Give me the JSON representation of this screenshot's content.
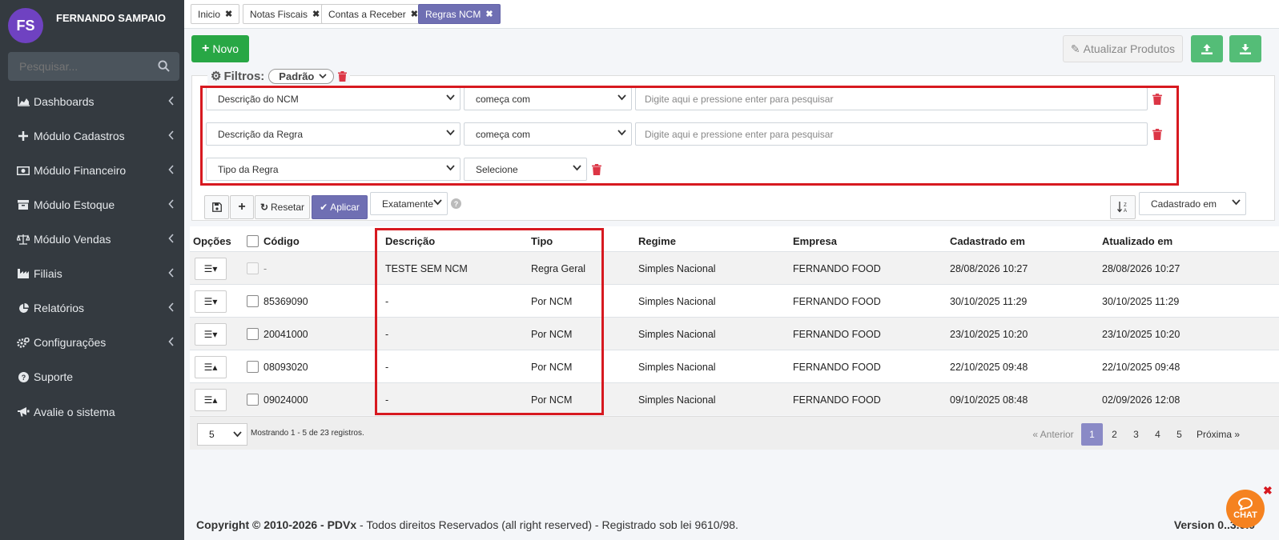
{
  "user": {
    "initials": "FS",
    "name": "FERNANDO SAMPAIO"
  },
  "sidebar": {
    "search_placeholder": "Pesquisar...",
    "items": [
      {
        "label": "Dashboards",
        "icon": "chart-area-icon"
      },
      {
        "label": "Módulo Cadastros",
        "icon": "plus-icon"
      },
      {
        "label": "Módulo Financeiro",
        "icon": "money-icon"
      },
      {
        "label": "Módulo Estoque",
        "icon": "archive-icon"
      },
      {
        "label": "Módulo Vendas",
        "icon": "balance-scale-icon"
      },
      {
        "label": "Filiais",
        "icon": "industry-icon"
      },
      {
        "label": "Relatórios",
        "icon": "pie-chart-icon"
      },
      {
        "label": "Configurações",
        "icon": "cogs-icon"
      },
      {
        "label": "Suporte",
        "icon": "question-circle-icon"
      },
      {
        "label": "Avalie o sistema",
        "icon": "bullhorn-icon"
      }
    ]
  },
  "tabs": [
    {
      "label": "Inicio"
    },
    {
      "label": "Notas Fiscais"
    },
    {
      "label": "Contas a Receber"
    },
    {
      "label": "Regras NCM"
    }
  ],
  "toolbar": {
    "novo": "Novo",
    "atualizar": "Atualizar Produtos"
  },
  "filters": {
    "legend": "Filtros:",
    "preset": "Padrão",
    "rows": [
      {
        "field": "Descrição do NCM",
        "operator": "começa com",
        "placeholder": "Digite aqui e pressione enter para pesquisar"
      },
      {
        "field": "Descrição da Regra",
        "operator": "começa com",
        "placeholder": "Digite aqui e pressione enter para pesquisar"
      },
      {
        "field": "Tipo da Regra",
        "operator": "Selecione"
      }
    ],
    "resetar": "Resetar",
    "aplicar": "Aplicar",
    "match": "Exatamente",
    "sort_field": "Cadastrado em"
  },
  "table": {
    "headers": {
      "opcoes": "Opções",
      "codigo": "Código",
      "descricao": "Descrição",
      "tipo": "Tipo",
      "regime": "Regime",
      "empresa": "Empresa",
      "cadastrado": "Cadastrado em",
      "atualizado": "Atualizado em"
    },
    "rows": [
      {
        "codigo": "-",
        "descricao": "TESTE SEM NCM",
        "tipo": "Regra Geral",
        "regime": "Simples Nacional",
        "empresa": "FERNANDO FOOD",
        "cadastrado": "28/08/2026 10:27",
        "atualizado": "28/08/2026 10:27"
      },
      {
        "codigo": "85369090",
        "descricao": "-",
        "tipo": "Por NCM",
        "regime": "Simples Nacional",
        "empresa": "FERNANDO FOOD",
        "cadastrado": "30/10/2025 11:29",
        "atualizado": "30/10/2025 11:29"
      },
      {
        "codigo": "20041000",
        "descricao": "-",
        "tipo": "Por NCM",
        "regime": "Simples Nacional",
        "empresa": "FERNANDO FOOD",
        "cadastrado": "23/10/2025 10:20",
        "atualizado": "23/10/2025 10:20"
      },
      {
        "codigo": "08093020",
        "descricao": "-",
        "tipo": "Por NCM",
        "regime": "Simples Nacional",
        "empresa": "FERNANDO FOOD",
        "cadastrado": "22/10/2025 09:48",
        "atualizado": "22/10/2025 09:48"
      },
      {
        "codigo": "09024000",
        "descricao": "-",
        "tipo": "Por NCM",
        "regime": "Simples Nacional",
        "empresa": "FERNANDO FOOD",
        "cadastrado": "09/10/2025 08:48",
        "atualizado": "02/09/2026 12:08"
      }
    ]
  },
  "pagination": {
    "page_size": "5",
    "showing": "Mostrando 1 - 5 de 23 registros.",
    "prev": "« Anterior",
    "pages": [
      "1",
      "2",
      "3",
      "4",
      "5"
    ],
    "next": "Próxima »"
  },
  "footer": {
    "copyright_bold": "Copyright © 2010-2026 - PDVx",
    "copyright_rest": " - Todos direitos Reservados (all right reserved) - Registrado sob lei 9610/98.",
    "version": "Version 0..3.0.0"
  },
  "chat": {
    "label": "CHAT"
  },
  "colors": {
    "sidebar": "#343a40",
    "primary": "#6f6fb3",
    "success": "#28a745",
    "danger": "#d71920",
    "chat": "#f58220"
  }
}
